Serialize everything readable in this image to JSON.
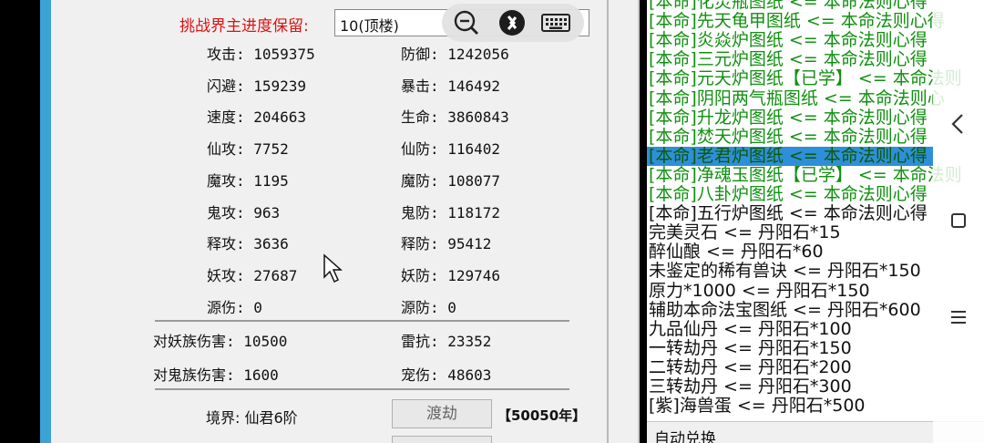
{
  "challenge": {
    "label": "挑战界主进度保留:",
    "selected": "10(顶楼)"
  },
  "stats_left": [
    "攻击: 1059375",
    "闪避: 159239",
    "速度: 204663",
    "仙攻: 7752",
    "魔攻: 1195",
    "鬼攻: 963",
    "释攻: 3636",
    "妖攻: 27687",
    "源伤: 0"
  ],
  "stats_right": [
    "防御: 1242056",
    "暴击: 146492",
    "生命: 3860843",
    "仙防: 116402",
    "魔防: 108077",
    "鬼防: 118172",
    "释防: 95412",
    "妖防: 129746",
    "源防: 0"
  ],
  "extra_left": [
    "对妖族伤害: 10500",
    "对鬼族伤害: 1600"
  ],
  "extra_right": [
    "雷抗: 23352",
    "宠伤: 48603"
  ],
  "realm": {
    "label": "境界: 仙君6阶",
    "button": "渡劫",
    "badge": "【50050年】"
  },
  "list_items": [
    {
      "text": "[本命]化灵瓶图纸 <= 本命法则心得",
      "style": "green"
    },
    {
      "text": "[本命]先天龟甲图纸 <= 本命法则心得",
      "style": "green"
    },
    {
      "text": "[本命]炎焱炉图纸 <= 本命法则心得",
      "style": "green"
    },
    {
      "text": "[本命]三元炉图纸 <= 本命法则心得",
      "style": "green"
    },
    {
      "text": "[本命]元天炉图纸【已学】 <= 本命法则",
      "style": "green"
    },
    {
      "text": "[本命]阴阳两气瓶图纸 <= 本命法则心",
      "style": "green"
    },
    {
      "text": "[本命]升龙炉图纸 <= 本命法则心得",
      "style": "green"
    },
    {
      "text": "[本命]焚天炉图纸 <= 本命法则心得",
      "style": "green"
    },
    {
      "text": "[本命]老君炉图纸 <= 本命法则心得",
      "style": "selected"
    },
    {
      "text": "[本命]净魂玉图纸【已学】 <= 本命法则",
      "style": "green"
    },
    {
      "text": "[本命]八卦炉图纸 <= 本命法则心得",
      "style": "green"
    },
    {
      "text": "[本命]五行炉图纸 <= 本命法则心得",
      "style": "black"
    },
    {
      "text": "完美灵石 <= 丹阳石*15",
      "style": "black"
    },
    {
      "text": "醉仙酿 <= 丹阳石*60",
      "style": "black"
    },
    {
      "text": "未鉴定的稀有兽诀 <= 丹阳石*150",
      "style": "black"
    },
    {
      "text": "原力*1000 <= 丹阳石*150",
      "style": "black"
    },
    {
      "text": "辅助本命法宝图纸 <= 丹阳石*600",
      "style": "black"
    },
    {
      "text": "九品仙丹 <= 丹阳石*100",
      "style": "black"
    },
    {
      "text": "一转劫丹 <= 丹阳石*150",
      "style": "black"
    },
    {
      "text": "二转劫丹 <= 丹阳石*200",
      "style": "black"
    },
    {
      "text": "三转劫丹 <= 丹阳石*300",
      "style": "black"
    },
    {
      "text": "[紫]海兽蛋 <= 丹阳石*500",
      "style": "black"
    }
  ],
  "auto_exchange": "自动兑换",
  "colors": {
    "accent_blue": "#3aa3d6",
    "selection": "#2e8fd9",
    "green_text": "#109010",
    "red_label": "#e01010"
  },
  "icons": [
    "zoom-out-icon",
    "remote-connect-icon",
    "keyboard-icon",
    "chevron-left-icon",
    "square-icon",
    "menu-icon",
    "mouse-cursor-icon"
  ]
}
